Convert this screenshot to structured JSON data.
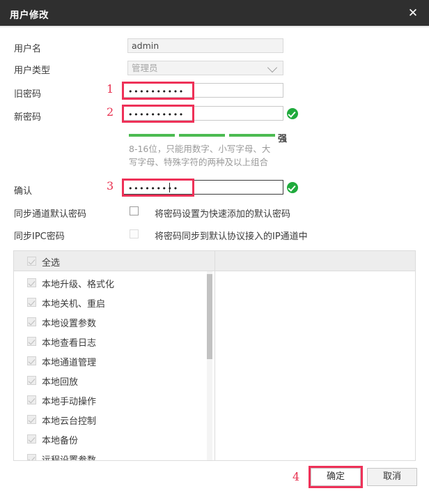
{
  "window": {
    "title": "用户修改",
    "close_icon": "close-icon",
    "close_glyph": "✕"
  },
  "form": {
    "username": {
      "label": "用户名",
      "value": "admin",
      "disabled": true
    },
    "usertype": {
      "label": "用户类型",
      "value": "管理员",
      "disabled": true,
      "options": [
        "管理员"
      ]
    },
    "old_password": {
      "label": "旧密码",
      "value": "••••••••••"
    },
    "new_password": {
      "label": "新密码",
      "value": "••••••••••",
      "valid_icon": "green-check-icon"
    },
    "strength": {
      "segments": 3,
      "label": "强"
    },
    "hint_line1": "8-16位，只能用数字、小写字母、大",
    "hint_line2": "写字母、特殊字符的两种及以上组合",
    "confirm": {
      "label": "确认",
      "value": "•••••••••",
      "valid_icon": "green-check-icon",
      "focused": true
    },
    "sync_channel": {
      "label": "同步通道默认密码",
      "text": "将密码设置为快速添加的默认密码",
      "checked": false,
      "disabled": false
    },
    "sync_ipc": {
      "label": "同步IPC密码",
      "text": "将密码同步到默认协议接入的IP通道中",
      "checked": false,
      "disabled": true
    }
  },
  "permissions": {
    "select_all": {
      "label": "全选",
      "checked": true,
      "disabled": true
    },
    "items": [
      {
        "label": "本地升级、格式化",
        "checked": true,
        "disabled": true
      },
      {
        "label": "本地关机、重启",
        "checked": true,
        "disabled": true
      },
      {
        "label": "本地设置参数",
        "checked": true,
        "disabled": true
      },
      {
        "label": "本地查看日志",
        "checked": true,
        "disabled": true
      },
      {
        "label": "本地通道管理",
        "checked": true,
        "disabled": true
      },
      {
        "label": "本地回放",
        "checked": true,
        "disabled": true
      },
      {
        "label": "本地手动操作",
        "checked": true,
        "disabled": true
      },
      {
        "label": "本地云台控制",
        "checked": true,
        "disabled": true
      },
      {
        "label": "本地备份",
        "checked": true,
        "disabled": true
      },
      {
        "label": "远程设置参数",
        "checked": true,
        "disabled": true
      }
    ]
  },
  "footer": {
    "ok": "确定",
    "cancel": "取消"
  },
  "annotations": {
    "n1": "1",
    "n2": "2",
    "n3": "3",
    "n4": "4",
    "color": "#ee3158"
  }
}
